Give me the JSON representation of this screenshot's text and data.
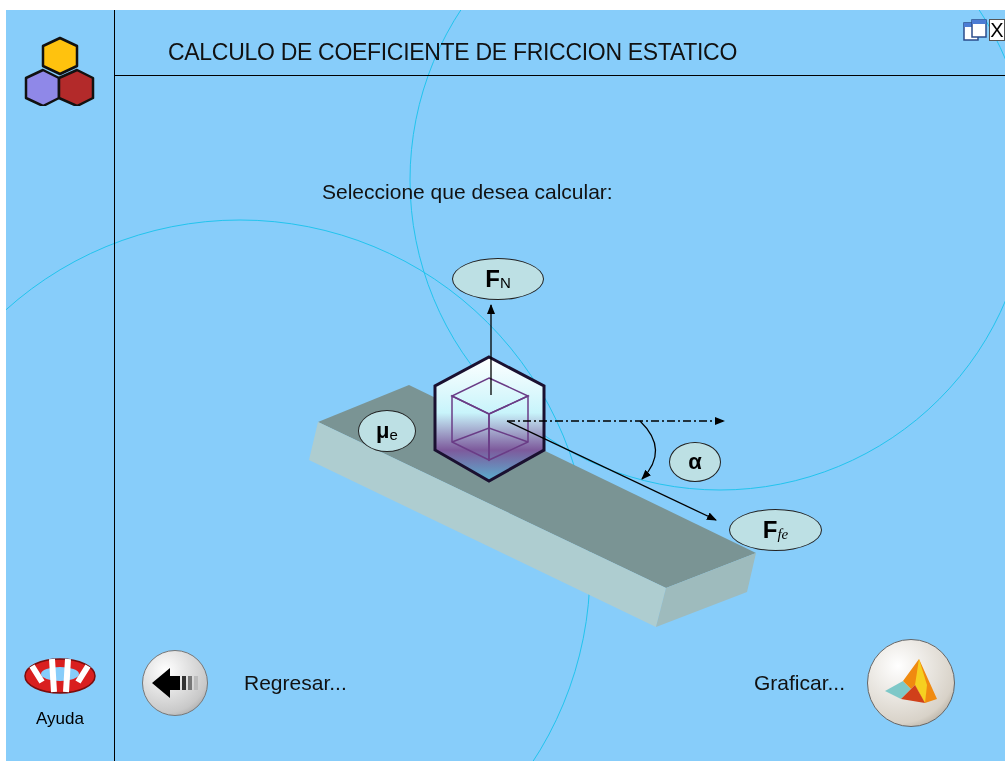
{
  "window": {
    "title": "CALCULO DE COEFICIENTE DE FRICCION ESTATICO",
    "close_label": "X"
  },
  "prompt": "Seleccione que desea calcular:",
  "diagram": {
    "labels": [
      {
        "kind": "normal_force",
        "text": "F$_{N}$"
      },
      {
        "kind": "coefficient",
        "text": "μ$_{e}$"
      },
      {
        "kind": "angle",
        "text": "α"
      },
      {
        "kind": "friction_force",
        "text": "F$_{fe}$"
      }
    ]
  },
  "sidebar": {
    "help_label": "Ayuda"
  },
  "nav": [
    {
      "kind": "back",
      "label": "Regresar..."
    },
    {
      "kind": "plot",
      "label": "Graficar..."
    }
  ]
}
